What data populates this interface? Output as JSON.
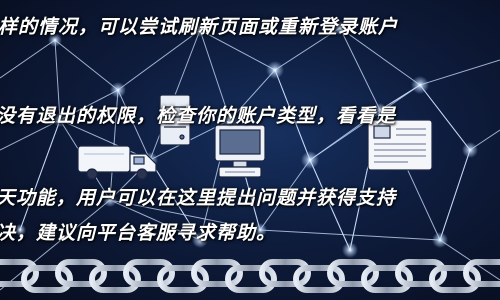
{
  "overlay": {
    "lines": [
      "样的情况，可以尝试刷新页面或重新登录账户",
      "没有退出的权限，检查你的账户类型，看看是",
      "天功能，用户可以在这里提出问题并获得支持",
      "决，建议向平台客服寻求帮助。"
    ]
  },
  "background": {
    "theme": "network-chain-illustration",
    "icons": [
      "truck-icon",
      "computer-icon",
      "server-icon",
      "document-icon",
      "chain-link-icon"
    ],
    "colors": {
      "background_dark": "#070d1e",
      "background_glow": "#16305f",
      "network_line": "#cfe3ff",
      "node_glow": "#ffffff"
    }
  }
}
